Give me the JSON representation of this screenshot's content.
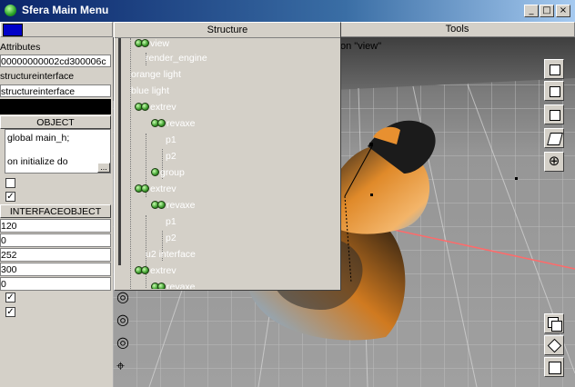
{
  "window": {
    "title": "Sfera Main Menu"
  },
  "header": {
    "structure_label": "Structure",
    "tools_label": "Tools",
    "viewport_label": "on \"view\""
  },
  "left": {
    "attributes_label": "Attributes",
    "id_value": "00000000002cd300006c",
    "class1": "structureinterface",
    "class2": "structureinterface",
    "object_button": "OBJECT",
    "script_line1": "global main_h;",
    "script_line2": "on initialize do",
    "ellipsis": "...",
    "interface_button": "INTERFACEOBJECT",
    "values": [
      "120",
      "0",
      "252",
      "300",
      "0"
    ]
  },
  "tree": {
    "nodes": [
      {
        "label": "view",
        "icon": "double-ball"
      },
      {
        "label": "render_engine",
        "icon": "none"
      },
      {
        "label": "orange light",
        "icon": "none"
      },
      {
        "label": "blue light",
        "icon": "none"
      },
      {
        "label": "extrev",
        "icon": "double-ball"
      },
      {
        "label": "revaxe",
        "icon": "double-ball"
      },
      {
        "label": "p1",
        "icon": "none"
      },
      {
        "label": "p2",
        "icon": "none"
      },
      {
        "label": "group",
        "icon": "single-ball"
      },
      {
        "label": "extrev",
        "icon": "double-ball"
      },
      {
        "label": "revaxe",
        "icon": "double-ball"
      },
      {
        "label": "p1",
        "icon": "none"
      },
      {
        "label": "p2",
        "icon": "none"
      },
      {
        "label": "u2 interface",
        "icon": "none"
      },
      {
        "label": "extrev",
        "icon": "double-ball"
      },
      {
        "label": "revaxe",
        "icon": "double-ball"
      }
    ]
  },
  "icons": {
    "app": "green-ball-icon",
    "minimize": "minimize-icon",
    "maximize": "maximize-icon",
    "close": "close-icon",
    "cursor": "hand-cursor-icon"
  },
  "colors": {
    "titlebar": "#0a246a",
    "node_text": "#ffffff",
    "orange": "#e08a2a",
    "blue": "#6fa8e0"
  }
}
